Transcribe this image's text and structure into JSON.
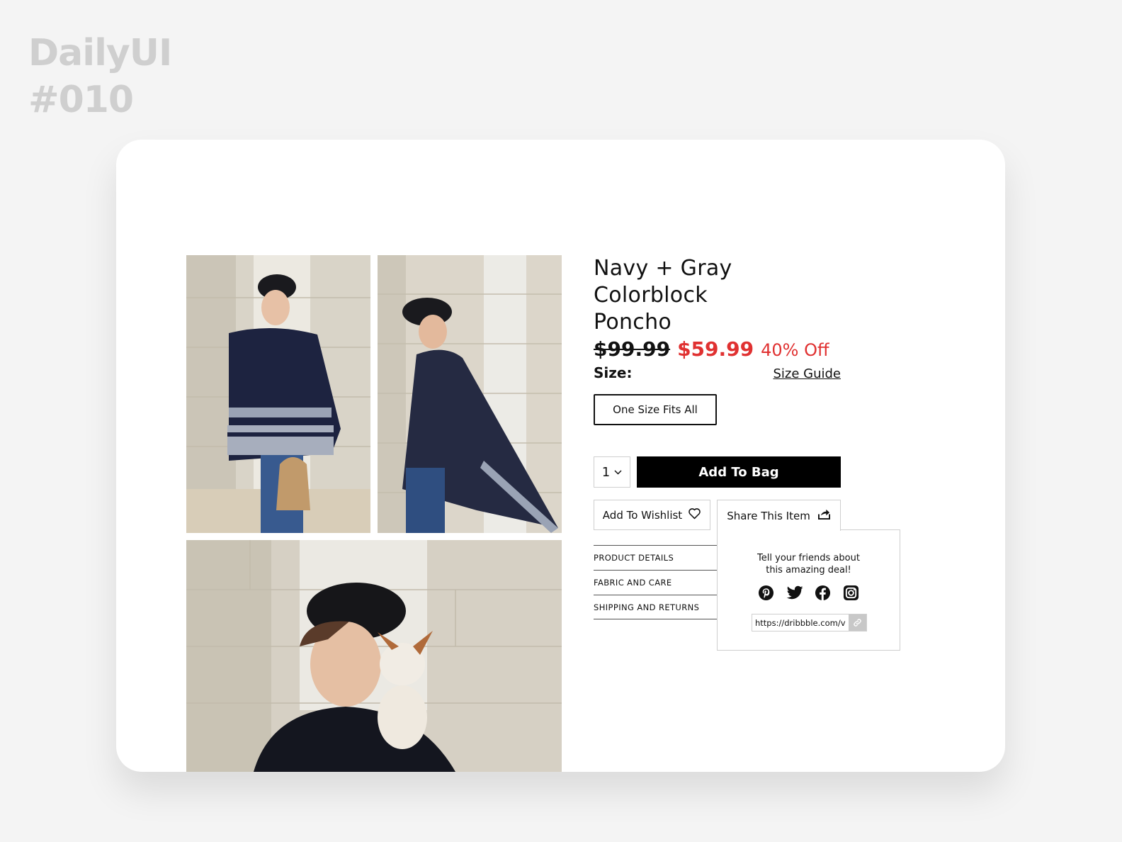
{
  "brand": {
    "line1": "DailyUI",
    "line2": "#010"
  },
  "product": {
    "title_line1": "Navy + Gray Colorblock",
    "title_line2": "Poncho",
    "old_price": "$99.99",
    "new_price": "$59.99",
    "discount": "40% Off"
  },
  "size": {
    "label": "Size:",
    "guide_link": "Size Guide",
    "option": "One Size Fits All"
  },
  "purchase": {
    "quantity": "1",
    "add_to_bag": "Add To Bag",
    "wishlist": "Add To Wishlist",
    "share": "Share This Item"
  },
  "accordion": [
    {
      "label": "PRODUCT DETAILS"
    },
    {
      "label": "FABRIC AND CARE"
    },
    {
      "label": "SHIPPING AND RETURNS"
    }
  ],
  "share_panel": {
    "text_line1": "Tell your friends about",
    "text_line2": "this amazing deal!",
    "url": "https://dribbble.com/vi",
    "networks": [
      "pinterest-icon",
      "twitter-icon",
      "facebook-icon",
      "instagram-icon"
    ]
  },
  "colors": {
    "sale": "#e03131",
    "button": "#000000",
    "background": "#f4f4f4"
  }
}
